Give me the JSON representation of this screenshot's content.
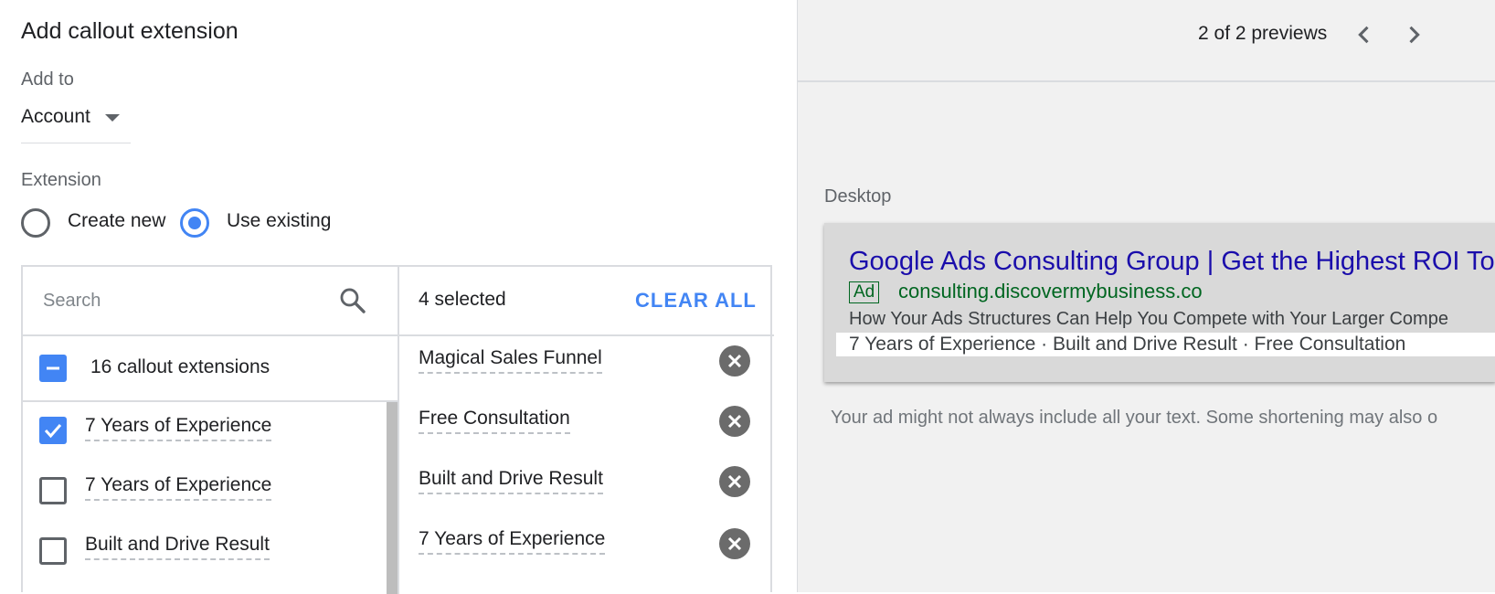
{
  "dialog": {
    "title": "Add callout extension",
    "add_to_label": "Add to",
    "add_to_value": "Account",
    "extension_label": "Extension",
    "radio_create": "Create new",
    "radio_existing": "Use existing",
    "selected_radio": "existing"
  },
  "list": {
    "search_placeholder": "Search",
    "master_label": "16 callout extensions",
    "items": [
      {
        "label": "7 Years of Experience",
        "checked": true
      },
      {
        "label": "7 Years of Experience",
        "checked": false
      },
      {
        "label": "Built and Drive Result",
        "checked": false
      }
    ]
  },
  "selected": {
    "count_label": "4 selected",
    "clear_all": "CLEAR ALL",
    "items": [
      "Magical Sales Funnel",
      "Free Consultation",
      "Built and Drive Result",
      "7 Years of Experience"
    ]
  },
  "preview": {
    "count_label": "2 of 2 previews",
    "device_label": "Desktop",
    "ad_title": "Google Ads Consulting Group | Get the Highest ROI To",
    "ad_badge": "Ad",
    "ad_url": "consulting.discovermybusiness.co",
    "ad_description": "How Your Ads Structures Can Help You Compete with Your Larger Compe",
    "ad_callouts": "7 Years of Experience · Built and Drive Result · Free Consultation",
    "notice": "Your ad might not always include all your text. Some shortening may also o"
  },
  "colors": {
    "accent": "#4285f4",
    "ad_title": "#1a0dab",
    "ad_url": "#006621"
  }
}
